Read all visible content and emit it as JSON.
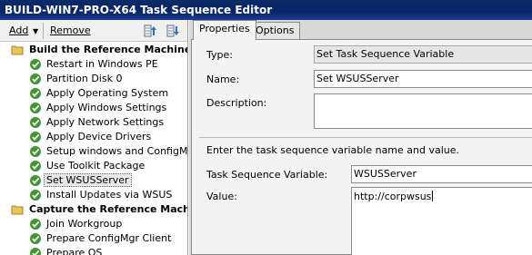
{
  "window": {
    "title": "BUILD-WIN7-PRO-X64 Task Sequence Editor"
  },
  "toolbar": {
    "add_label": "Add",
    "remove_label": "Remove"
  },
  "tree": {
    "groups": [
      {
        "label": "Build the Reference Machine",
        "steps": [
          {
            "label": "Restart in Windows PE"
          },
          {
            "label": "Partition Disk 0"
          },
          {
            "label": "Apply Operating System"
          },
          {
            "label": "Apply Windows Settings"
          },
          {
            "label": "Apply Network Settings"
          },
          {
            "label": "Apply Device Drivers"
          },
          {
            "label": "Setup windows and ConfigMgr"
          },
          {
            "label": "Use Toolkit Package"
          },
          {
            "label": "Set WSUSServer",
            "selected": true
          },
          {
            "label": "Install Updates via WSUS"
          }
        ]
      },
      {
        "label": "Capture the Reference Machin",
        "steps": [
          {
            "label": "Join Workgroup"
          },
          {
            "label": "Prepare ConfigMgr Client"
          },
          {
            "label": "Prepare OS"
          }
        ]
      }
    ]
  },
  "tabs": {
    "properties": "Properties",
    "options": "Options"
  },
  "properties": {
    "type_label": "Type:",
    "type_value": "Set Task Sequence Variable",
    "name_label": "Name:",
    "name_value": "Set WSUSServer",
    "description_label": "Description:",
    "description_value": "",
    "instructions": "Enter the task sequence variable name and value.",
    "variable_label": "Task Sequence Variable:",
    "variable_value": "WSUSServer",
    "value_label": "Value:",
    "value_value": "http://corpwsus"
  },
  "colors": {
    "titlebar": "#0a246a",
    "check_green": "#3a9a2a",
    "folder_yellow": "#e8c75a"
  }
}
